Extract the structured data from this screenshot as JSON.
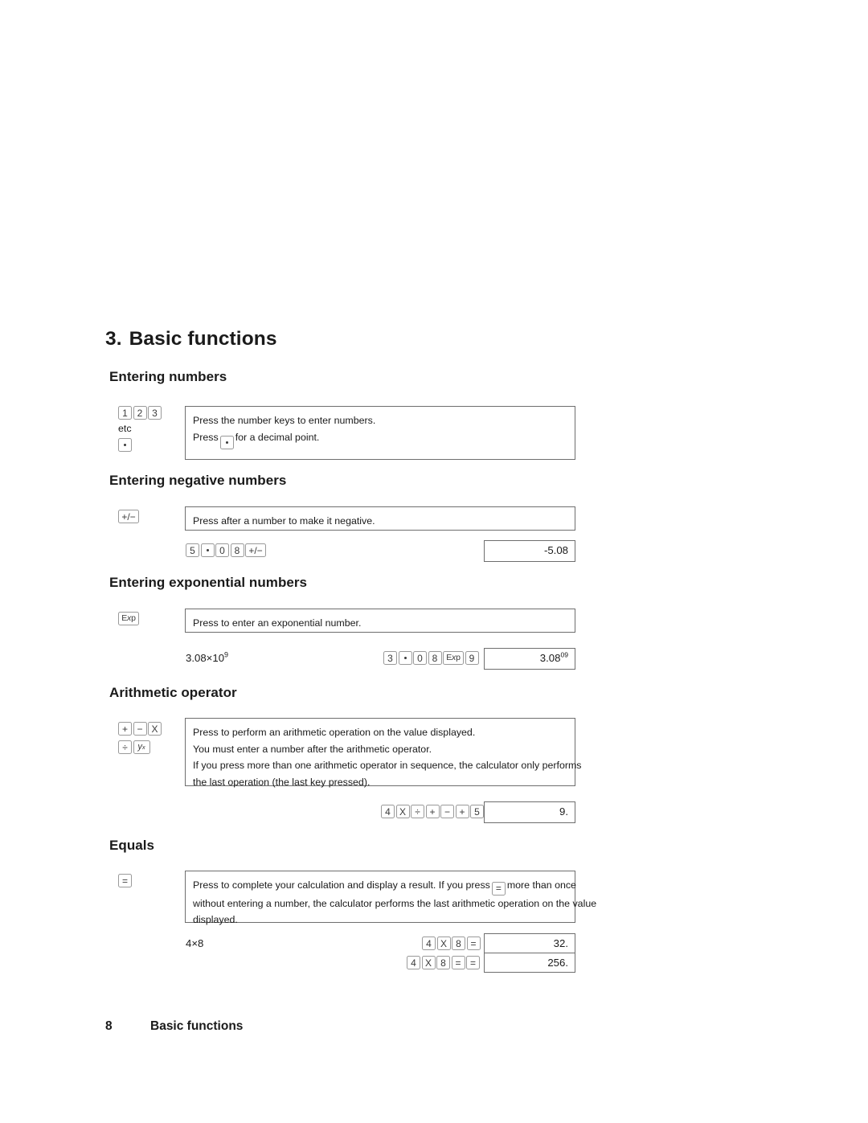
{
  "document": {
    "chapter_number": "3.",
    "chapter_title": "Basic functions",
    "footer_page_number": "8",
    "footer_title": "Basic functions"
  },
  "sections": {
    "entering_numbers": {
      "heading": "Entering numbers",
      "keys_label": [
        "1",
        "2",
        "3"
      ],
      "etc_label": "etc",
      "decimal_key": ".",
      "desc_line1": "Press the number keys to enter numbers.",
      "desc_line2_before": "Press",
      "desc_line2_after": "for a decimal point."
    },
    "entering_negative_numbers": {
      "heading": "Entering negative numbers",
      "key_label": "+/−",
      "desc_line1": "Press after a number to make it negative.",
      "example_keys": [
        "5",
        ".",
        "0",
        "8",
        "+/−"
      ],
      "example_result": "-5.08"
    },
    "entering_exponential_numbers": {
      "heading": "Entering exponential numbers",
      "key_label": "Exp",
      "desc_line1": "Press to enter an exponential number.",
      "example_expression": "3.08×10",
      "example_expression_exponent": "9",
      "example_keys": [
        "3",
        ".",
        "0",
        "8",
        "Exp",
        "9"
      ],
      "example_result_mantissa": "3.08",
      "example_result_exponent": "09"
    },
    "arithmetic_operator": {
      "heading": "Arithmetic operator",
      "keys_row1": [
        "+",
        "−",
        "X"
      ],
      "keys_row2": [
        "÷",
        "y^x"
      ],
      "desc_line1": "Press to perform an arithmetic operation on the value displayed.",
      "desc_line2": "You must enter a number after the arithmetic operator.",
      "desc_line3": "If you press more than one arithmetic operator in sequence, the calculator only performs",
      "desc_line4": "the last operation (the last key pressed).",
      "example_keys": [
        "4",
        "X",
        "÷",
        "+",
        "−",
        "+",
        "5"
      ],
      "example_result": "9."
    },
    "equals": {
      "heading": "Equals",
      "key_label": "=",
      "desc_line1_part1": "Press to complete your calculation and display a result.  If you press",
      "desc_line1_part2": "more than once",
      "desc_line2": "without entering a number, the calculator performs the last arithmetic operation on the value",
      "desc_line3": "displayed.",
      "example_expression": "4×8",
      "example_keys_row1": [
        "4",
        "X",
        "8",
        "="
      ],
      "example_result_row1": "32.",
      "example_keys_row2": [
        "4",
        "X",
        "8",
        "=",
        "="
      ],
      "example_result_row2": "256."
    }
  },
  "colors": {
    "text": "#1a1a1a",
    "box_border": "#6e6e6e",
    "key_border": "#9a9a9a",
    "key_text": "#3a3a3a",
    "background": "#ffffff"
  }
}
